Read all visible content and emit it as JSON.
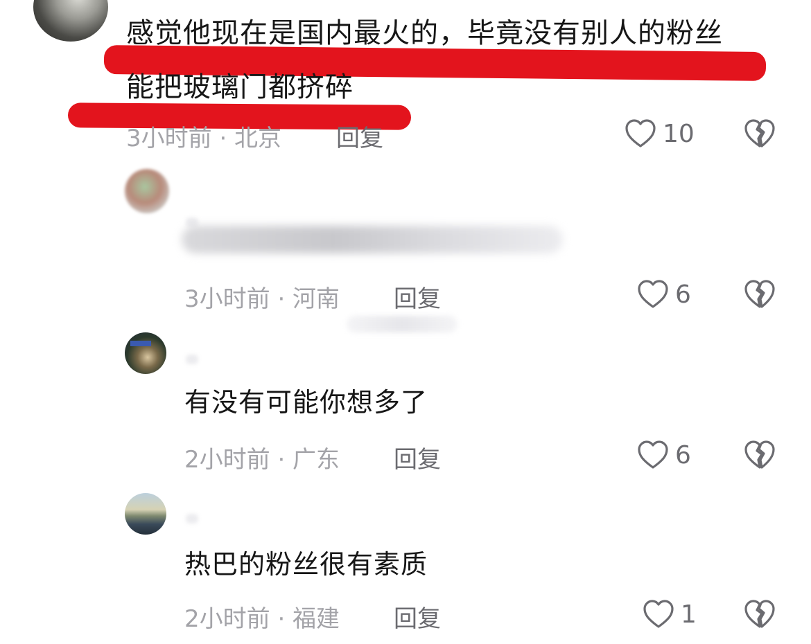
{
  "comments": [
    {
      "text_line1": "感觉他现在是国内最火的，毕竟没有别人的粉丝",
      "text_line2": "能把玻璃门都挤碎",
      "time": "3小时前 · 北京",
      "reply": "回复",
      "likes": "10"
    },
    {
      "text": "",
      "time": "3小时前 · 河南",
      "reply": "回复",
      "likes": "6"
    },
    {
      "text": "有没有可能你想多了",
      "time": "2小时前 · 广东",
      "reply": "回复",
      "likes": "6"
    },
    {
      "text": "热巴的粉丝很有素质",
      "time": "2小时前 · 福建",
      "reply": "回复",
      "likes": "1"
    }
  ],
  "colors": {
    "highlight": "#e3141d",
    "meta_text": "#a3a3a8",
    "icon": "#6b6b70"
  },
  "icons": {
    "like": "heart-outline-icon",
    "dislike": "broken-heart-icon"
  }
}
